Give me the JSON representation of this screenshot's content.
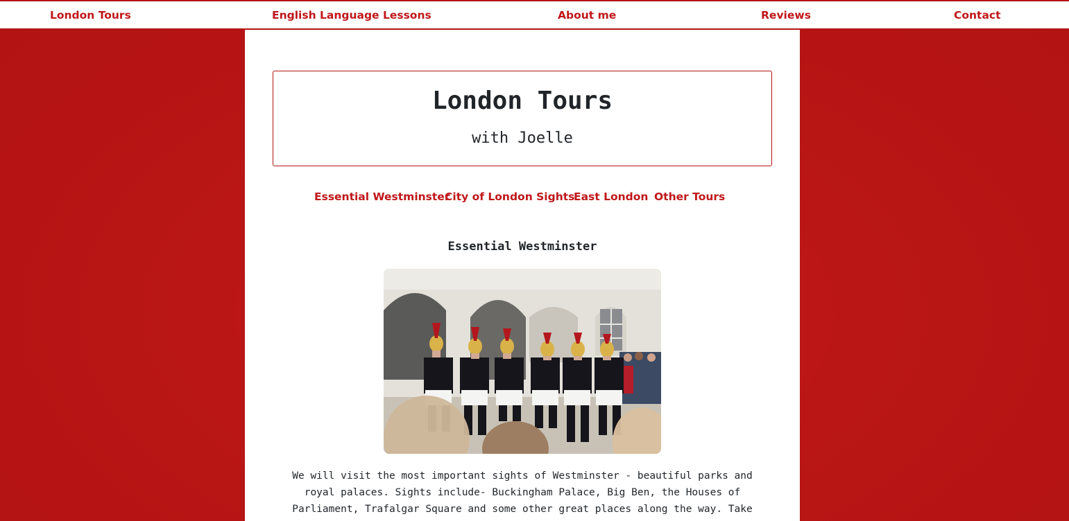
{
  "topnav": {
    "items": [
      "London Tours",
      "English Language Lessons",
      "About me",
      "Reviews",
      "Contact"
    ]
  },
  "header": {
    "title": "London Tours",
    "subtitle": "with Joelle"
  },
  "tours_nav": {
    "items": [
      "Essential Westminster",
      "City of London Sights",
      "East London",
      "Other Tours"
    ]
  },
  "section": {
    "title": "Essential Westminster",
    "image_icon": "guards-photo",
    "description_lines": [
      "We will visit the most important sights of Westminster - beautiful parks and",
      "royal palaces. Sights include- Buckingham Palace, Big Ben, the Houses of",
      "Parliament, Trafalgar Square and some other great places along the way. Take"
    ]
  },
  "colors": {
    "accent": "#c0171a",
    "background": "#b81515",
    "text": "#212529"
  }
}
